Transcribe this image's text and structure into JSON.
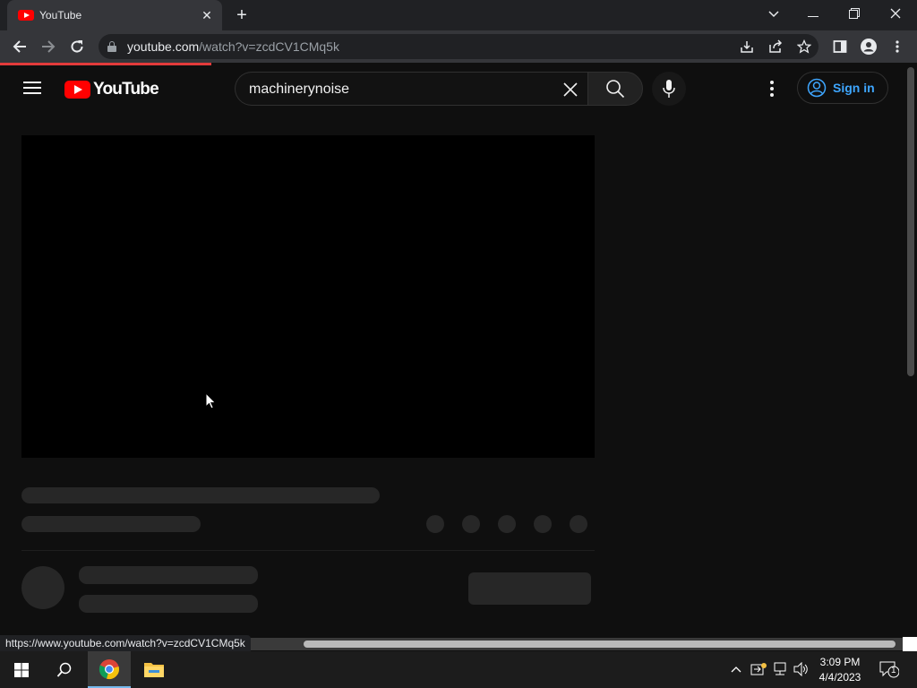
{
  "browser": {
    "tab_title": "YouTube",
    "url_host": "youtube.com",
    "url_path": "/watch?v=zcdCV1CMq5k",
    "status_url": "https://www.youtube.com/watch?v=zcdCV1CMq5k"
  },
  "youtube": {
    "logo_text": "YouTube",
    "search_query": "machinerynoise",
    "sign_in_label": "Sign in"
  },
  "taskbar": {
    "time": "3:09 PM",
    "date": "4/4/2023",
    "notification_count": "1"
  },
  "colors": {
    "youtube_red": "#ff0000",
    "sign_in_blue": "#3ea6ff",
    "loading_bar": "#e33b3b",
    "page_background": "#0f0f0f"
  }
}
